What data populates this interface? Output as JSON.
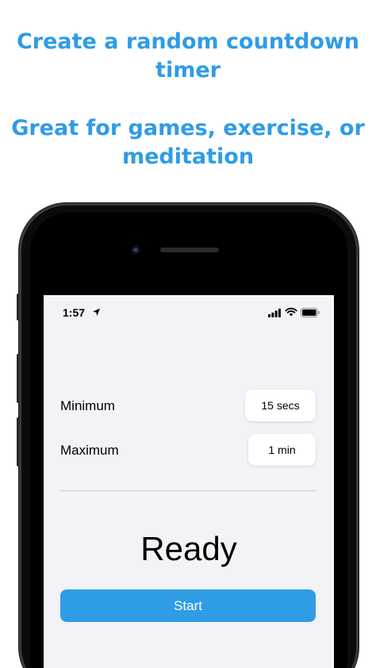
{
  "promo": {
    "headline_1": "Create a random countdown timer",
    "headline_2": "Great for games, exercise, or meditation"
  },
  "status_bar": {
    "time": "1:57",
    "icons": [
      "location-arrow-icon",
      "cellular-signal-icon",
      "wifi-icon",
      "battery-icon"
    ]
  },
  "settings": {
    "minimum_label": "Minimum",
    "minimum_value": "15 secs",
    "maximum_label": "Maximum",
    "maximum_value": "1 min"
  },
  "timer": {
    "status": "Ready",
    "start_label": "Start"
  },
  "colors": {
    "accent": "#2f9ce6",
    "screen_background": "#f2f2f7"
  }
}
